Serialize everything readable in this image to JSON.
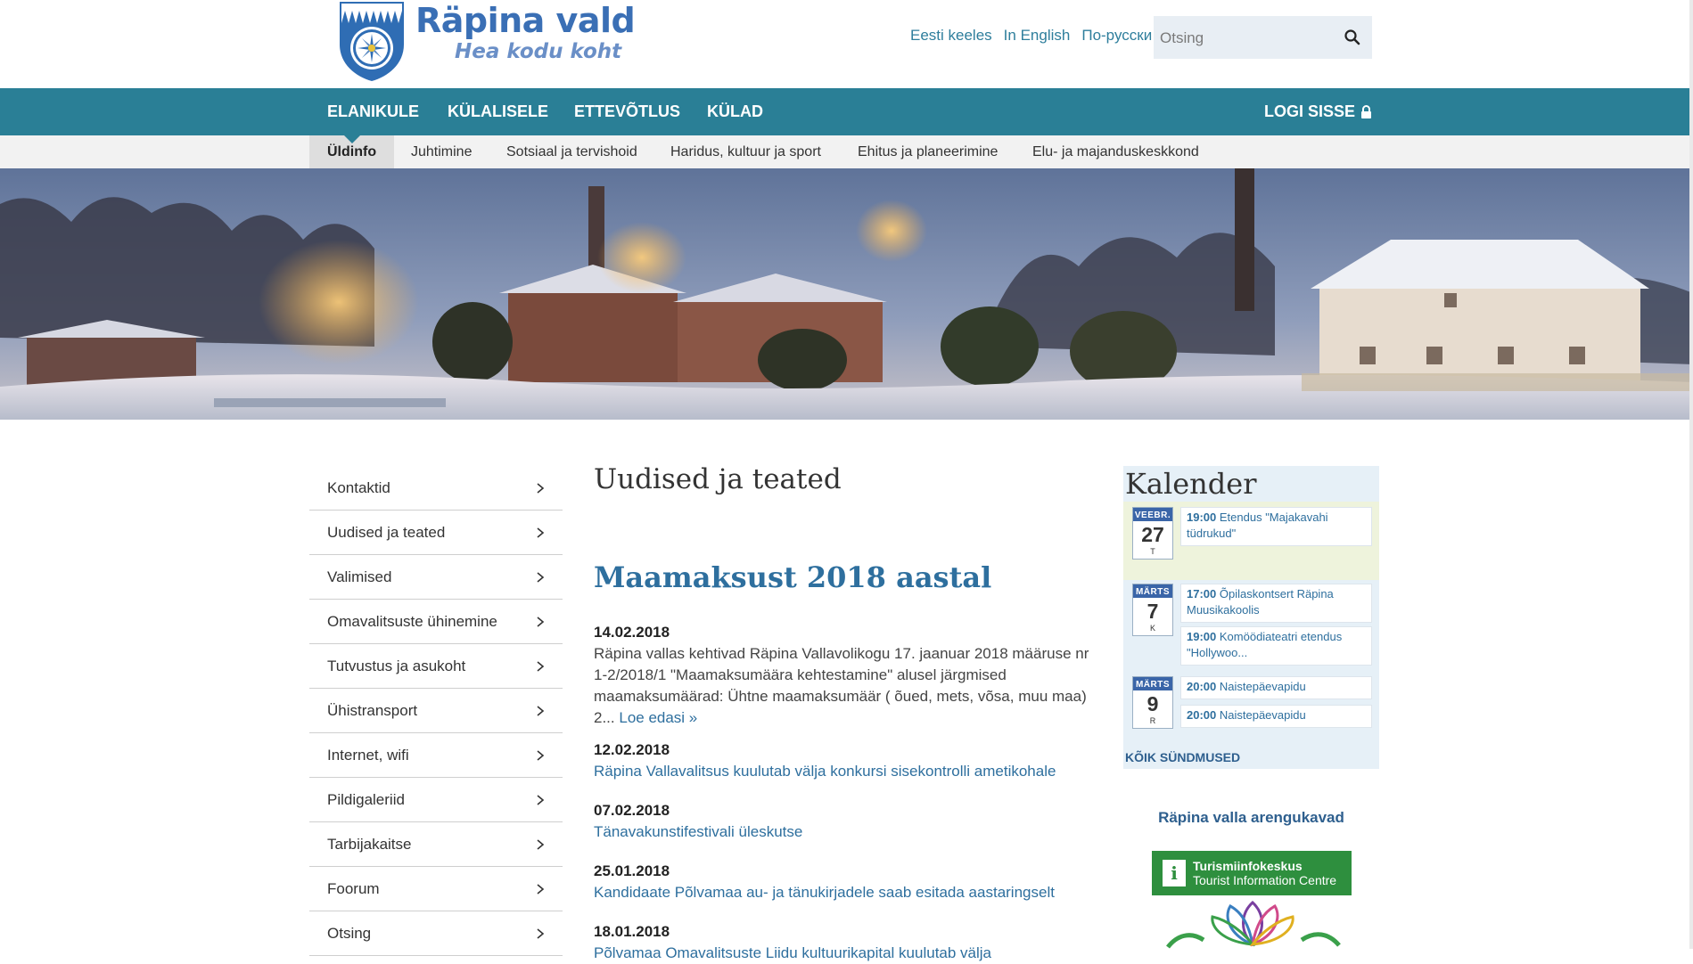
{
  "header": {
    "logo_title": "Räpina vald",
    "logo_slogan": "Hea kodu koht",
    "languages": [
      "Eesti keeles",
      "In English",
      "По-русски"
    ],
    "search_placeholder": "Otsing"
  },
  "main_nav": {
    "items": [
      "ELANIKULE",
      "KÜLALISELE",
      "ETTEVÕTLUS",
      "KÜLAD"
    ],
    "login": "LOGI SISSE"
  },
  "sub_nav": {
    "items": [
      "Üldinfo",
      "Juhtimine",
      "Sotsiaal ja tervishoid",
      "Haridus, kultuur ja sport",
      "Ehitus ja planeerimine",
      "Elu- ja majanduskeskkond"
    ],
    "active": "Üldinfo"
  },
  "left_menu": {
    "items": [
      "Kontaktid",
      "Uudised ja teated",
      "Valimised",
      "Omavalitsuste ühinemine",
      "Tutvustus ja asukoht",
      "Ühistransport",
      "Internet, wifi",
      "Pildigaleriid",
      "Tarbijakaitse",
      "Foorum",
      "Otsing"
    ]
  },
  "content": {
    "page_title": "Uudised ja teated",
    "article_title": "Maamaksust 2018 aastal",
    "news": [
      {
        "date": "14.02.2018",
        "text": "Räpina vallas kehtivad Räpina Vallavolikogu 17. jaanuar 2018 määruse nr 1-2/2018/1 \"Maamaksumäära kehtestamine\" alusel järgmised maamaksumäärad: Ühtne maamaksumäär ( õued, mets, võsa, muu maa) 2...",
        "read_more": "Loe edasi »"
      },
      {
        "date": "12.02.2018",
        "title": "Räpina Vallavalitsus kuulutab välja konkursi sisekontrolli ametikohale"
      },
      {
        "date": "07.02.2018",
        "title": "Tänavakunstifestivali üleskutse"
      },
      {
        "date": "25.01.2018",
        "title": "Kandidaate Põlvamaa au- ja tänukirjadele saab esitada aastaringselt"
      },
      {
        "date": "18.01.2018",
        "title": "Põlvamaa Omavalitsuste Liidu kultuurikapital kuulutab välja"
      }
    ]
  },
  "calendar": {
    "title": "Kalender",
    "days": [
      {
        "month": "VEEBR.",
        "day": "27",
        "weekday": "T",
        "events": [
          {
            "time": "19:00",
            "title": "Etendus \"Majakavahi tüdrukud\""
          }
        ]
      },
      {
        "month": "MÄRTS",
        "day": "7",
        "weekday": "K",
        "events": [
          {
            "time": "17:00",
            "title": "Õpilaskontsert Räpina Muusikakoolis"
          },
          {
            "time": "19:00",
            "title": "Komöödiateatri etendus \"Hollywoo..."
          }
        ]
      },
      {
        "month": "MÄRTS",
        "day": "9",
        "weekday": "R",
        "events": [
          {
            "time": "20:00",
            "title": "Naistepäevapidu"
          },
          {
            "time": "20:00",
            "title": "Naistepäevapidu"
          }
        ]
      }
    ],
    "all_events": "KÕIK SÜNDMUSED"
  },
  "sidebar": {
    "development_plans": "Räpina valla arengukavad",
    "tic_line1": "Turismiinfokeskus",
    "tic_line2": "Tourist Information Centre"
  },
  "colors": {
    "nav": "#2a7f96",
    "link": "#2e6f9e",
    "logo": "#3a6fb5",
    "subnav_bg": "#f2f2f2",
    "calendar_bg": "#e6f0f7"
  }
}
